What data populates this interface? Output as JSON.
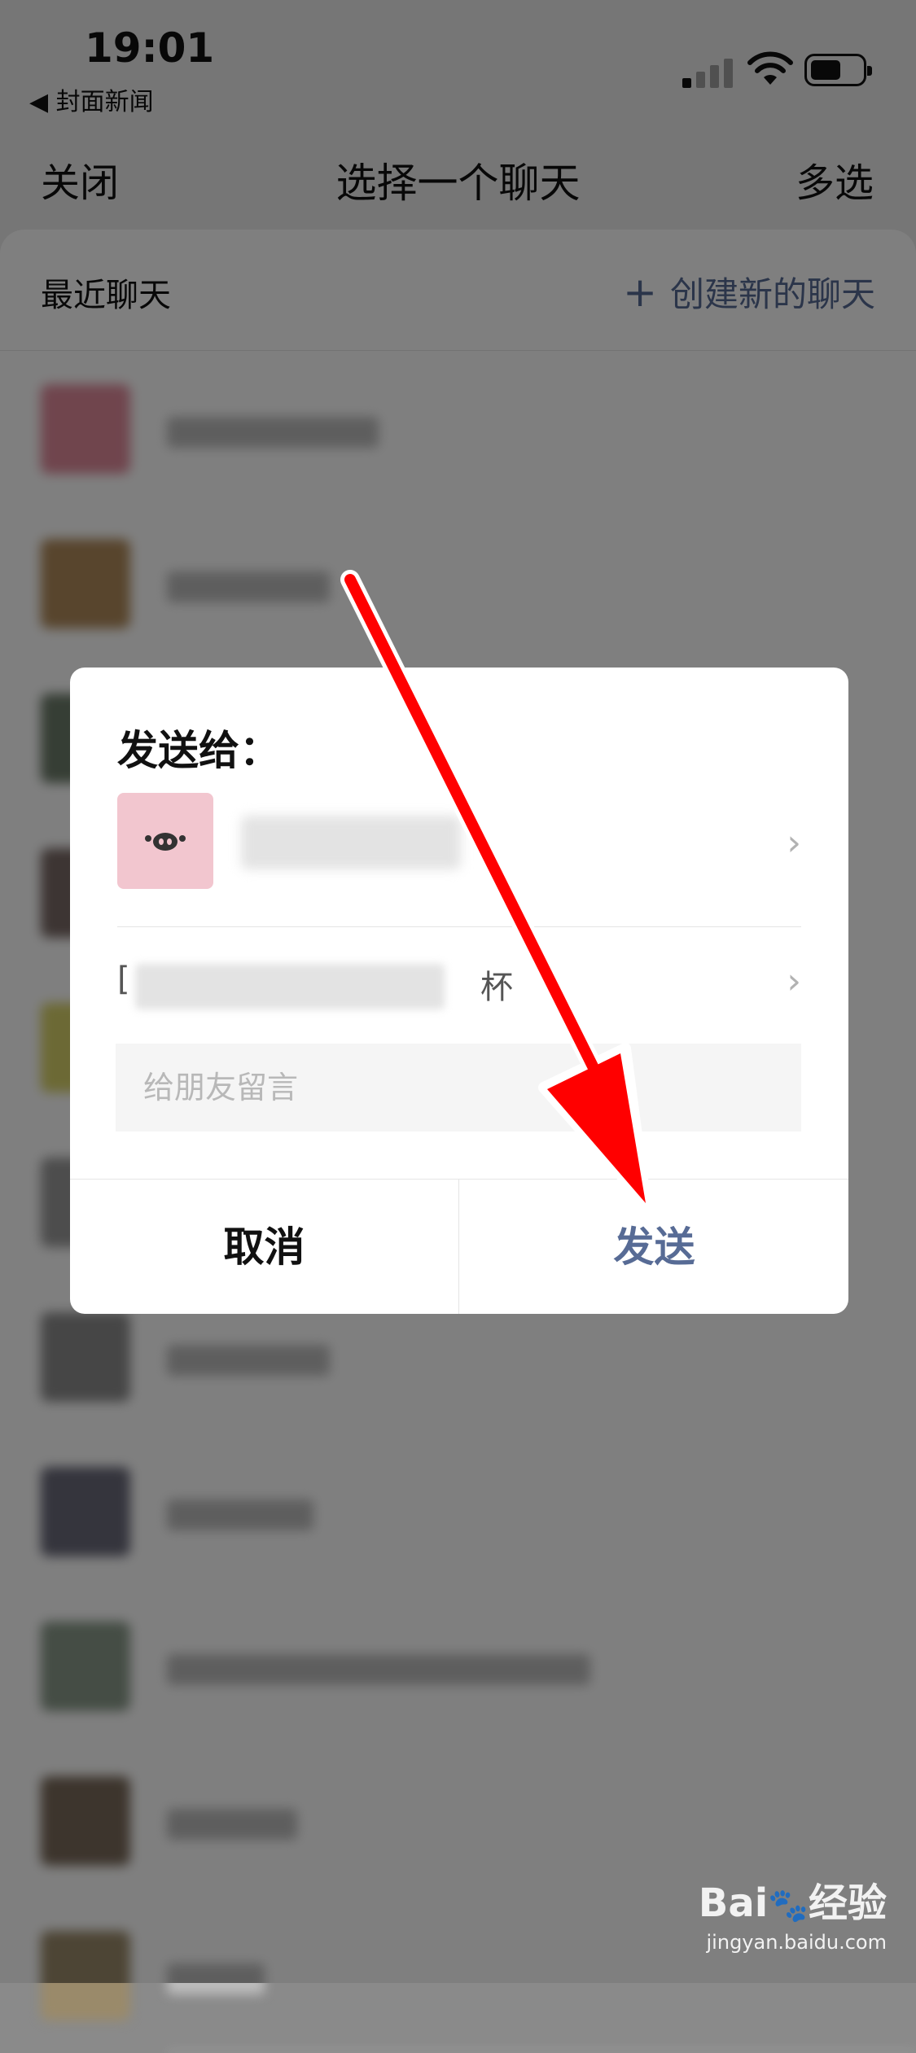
{
  "status_bar": {
    "time": "19:01",
    "back_app": "◀ 封面新闻",
    "icons": [
      "cellular-signal-icon",
      "wifi-icon",
      "battery-icon"
    ]
  },
  "nav": {
    "close": "关闭",
    "title": "选择一个聊天",
    "multi_select": "多选"
  },
  "recent": {
    "title": "最近聊天",
    "create_new": "创建新的聊天"
  },
  "dialog": {
    "send_to": "发送给：",
    "recipient_avatar_icon": "pig-icon",
    "content_prefix": "[",
    "content_suffix": "杯",
    "message_placeholder": "给朋友留言",
    "message_value": "",
    "cancel": "取消",
    "send": "发送"
  },
  "watermark": {
    "logo": "Bai",
    "logo_tail": "经验",
    "url": "jingyan.baidu.com"
  },
  "colors": {
    "link_blue": "#576b95",
    "arrow_red": "#ff0000",
    "avatar_pink": "#f2c6cf"
  }
}
